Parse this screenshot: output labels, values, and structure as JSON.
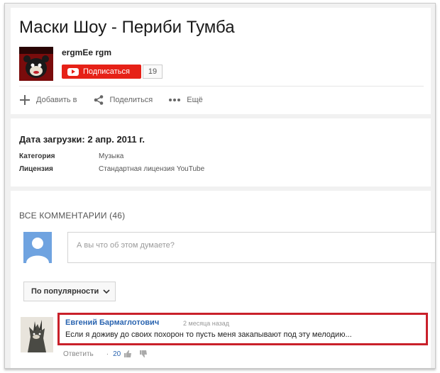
{
  "video": {
    "title": "Маски Шоу - Периби Тумба",
    "channel_name": "ergmEe rgm",
    "subscribe_label": "Подписаться",
    "subscriber_count": "19"
  },
  "actions": {
    "add_label": "Добавить в",
    "share_label": "Поделиться",
    "more_label": "Ещё"
  },
  "details": {
    "upload_date": "Дата загрузки: 2 апр. 2011 г.",
    "category_label": "Категория",
    "category_value": "Музыка",
    "license_label": "Лицензия",
    "license_value": "Стандартная лицензия YouTube"
  },
  "comments": {
    "header": "ВСЕ КОММЕНТАРИИ (46)",
    "input_placeholder": "А вы что об этом думаете?",
    "sort_label": "По популярности",
    "items": [
      {
        "author": "Евгений Бармаглотович",
        "time": "2 месяца назад",
        "text": "Если я доживу до своих похорон то пусть меня закапывают под эту мелодию...",
        "reply_label": "Ответить",
        "likes": "20"
      }
    ]
  },
  "colors": {
    "subscribe_red": "#e62117",
    "highlight_border": "#c9202a",
    "link_blue": "#2a64b0"
  }
}
